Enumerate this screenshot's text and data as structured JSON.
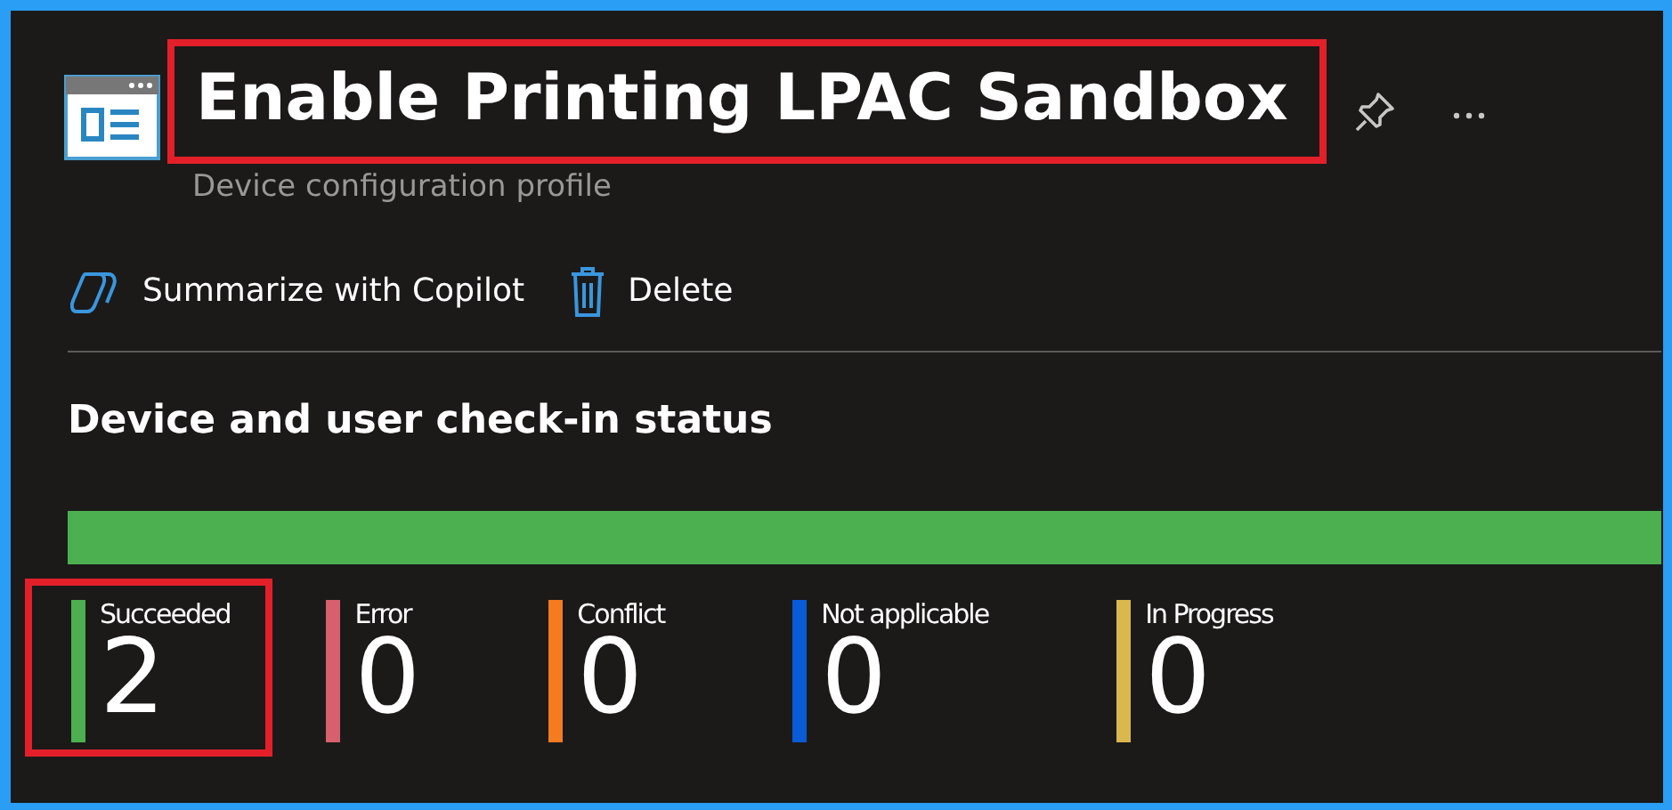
{
  "header": {
    "title": "Enable Printing LPAC Sandbox",
    "title_highlighted": true,
    "subtitle": "Device configuration profile"
  },
  "toolbar": [
    {
      "kind": "copilot",
      "label": "Summarize with Copilot"
    },
    {
      "kind": "delete",
      "label": "Delete"
    }
  ],
  "section": {
    "heading": "Device and user check-in status",
    "progress": {
      "level": 1
    },
    "tiles": [
      {
        "label": "Succeeded",
        "value": "2",
        "color": "#4caf50",
        "highlighted": true
      },
      {
        "label": "Error",
        "value": "0",
        "color": "#d7606e",
        "highlighted": false
      },
      {
        "label": "Conflict",
        "value": "0",
        "color": "#f47b20",
        "highlighted": false
      },
      {
        "label": "Not applicable",
        "value": "0",
        "color": "#0a5bd6",
        "highlighted": false
      },
      {
        "label": "In Progress",
        "value": "0",
        "color": "#d9b84d",
        "highlighted": false
      }
    ]
  }
}
